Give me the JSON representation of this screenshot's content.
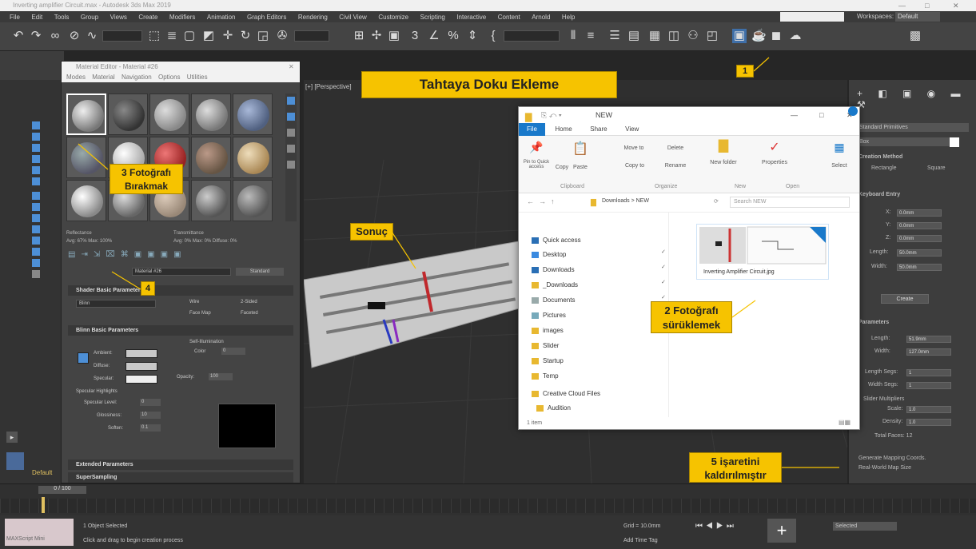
{
  "window": {
    "title": "Inverting amplifier Circuit.max - Autodesk 3ds Max 2019"
  },
  "menubar": [
    "File",
    "Edit",
    "Tools",
    "Group",
    "Views",
    "Create",
    "Modifiers",
    "Animation",
    "Graph Editors",
    "Rendering",
    "Civil View",
    "Customize",
    "Scripting",
    "Interactive",
    "Content",
    "Arnold",
    "Help"
  ],
  "toolbar": {
    "workspace_label": "Workspaces:",
    "workspace_value": "Default"
  },
  "viewport": {
    "label": "[+] [Perspective] [Standard] [Default Shading]"
  },
  "material_editor": {
    "title": "Material Editor - Material #26",
    "menu": [
      "Modes",
      "Material",
      "Navigation",
      "Options",
      "Utilities"
    ],
    "reflectance": "Reflectance",
    "transmittance": "Transmittance",
    "reflectance_vals": "Avg: 67% Max: 100%",
    "transmittance_vals": "Avg: 0% Max: 0% Diffuse: 0%",
    "material_name": "Material #26",
    "material_type": "Standard",
    "sections": {
      "shader_basic": "Shader Basic Parameters",
      "blinn_basic": "Blinn Basic Parameters",
      "extended": "Extended Parameters",
      "supersampling": "SuperSampling"
    },
    "shader": "Blinn",
    "wire": "Wire",
    "two_sided": "2-Sided",
    "face_map": "Face Map",
    "faceted": "Faceted",
    "ambient": "Ambient:",
    "diffuse": "Diffuse:",
    "specular": "Specular:",
    "self_illum": "Self-Illumination",
    "color": "Color",
    "color_val": "0",
    "opacity": "Opacity:",
    "opacity_val": "100",
    "spec_highlights": "Specular Highlights",
    "spec_level": "Specular Level:",
    "spec_level_val": "0",
    "glossiness": "Glossiness:",
    "glossiness_val": "10",
    "soften": "Soften:",
    "soften_val": "0.1"
  },
  "explorer": {
    "title": "NEW",
    "tabs": [
      "File",
      "Home",
      "Share",
      "View"
    ],
    "ribbon": {
      "pin": "Pin to Quick access",
      "copy": "Copy",
      "paste": "Paste",
      "move_to": "Move to",
      "delete": "Delete",
      "copy_to": "Copy to",
      "rename": "Rename",
      "new_folder": "New folder",
      "properties": "Properties",
      "select": "Select",
      "groups": [
        "Clipboard",
        "Organize",
        "New",
        "Open"
      ]
    },
    "path": "Downloads  >  NEW",
    "search": "Search NEW",
    "nav": [
      "Quick access",
      "Desktop",
      "Downloads",
      "_Downloads",
      "Documents",
      "Pictures",
      "images",
      "Slider",
      "Startup",
      "Temp",
      "Creative Cloud Files",
      "Audition"
    ],
    "file_name": "Inverting Amplifier Circuit.jpg",
    "status": "1 item"
  },
  "right_panel": {
    "object_type": "Standard Primitives",
    "object": "Box",
    "creation_method": "Creation Method",
    "rectangle": "Rectangle",
    "square": "Square",
    "keyboard_entry": "Keyboard Entry",
    "x": "X:",
    "y": "Y:",
    "z": "Z:",
    "xyz_val": "0.0mm",
    "length": "Length:",
    "width": "Width:",
    "length_val": "50.0mm",
    "width_val": "50.0mm",
    "create": "Create",
    "parameters": "Parameters",
    "p_length": "Length:",
    "p_width": "Width:",
    "p_length_val": "51.9mm",
    "p_width_val": "127.0mm",
    "length_segs": "Length Segs:",
    "width_segs": "Width Segs:",
    "segs_val": "1",
    "slider_mult": "Slider Multipliers",
    "scale": "Scale:",
    "density": "Density:",
    "mult_val": "1.0",
    "total_faces": "Total Faces: 12",
    "gen_coords": "Generate Mapping Coords.",
    "real_world": "Real-World Map Size"
  },
  "timeline": {
    "frame": "0 / 100"
  },
  "status": {
    "objects": "1 Object Selected",
    "prompt": "Click and drag to begin creation process",
    "grid": "Grid = 10.0mm",
    "add_time_tag": "Add Time Tag",
    "selected": "Selected",
    "default": "Default",
    "maxscript": "MAXScript Mini"
  },
  "callouts": {
    "c1": "1",
    "c2": "2 Fotoğrafı sürüklemek",
    "c3": "3 Fotoğrafı Bırakmak",
    "c4": "4",
    "c5": "5 işaretini kaldırılmıştır",
    "title": "Tahtaya Doku Ekleme",
    "result": "Sonuç"
  },
  "colors": {
    "accent": "#f6c300",
    "max_blue": "#4d8fd6",
    "explorer_blue": "#1979ca"
  }
}
